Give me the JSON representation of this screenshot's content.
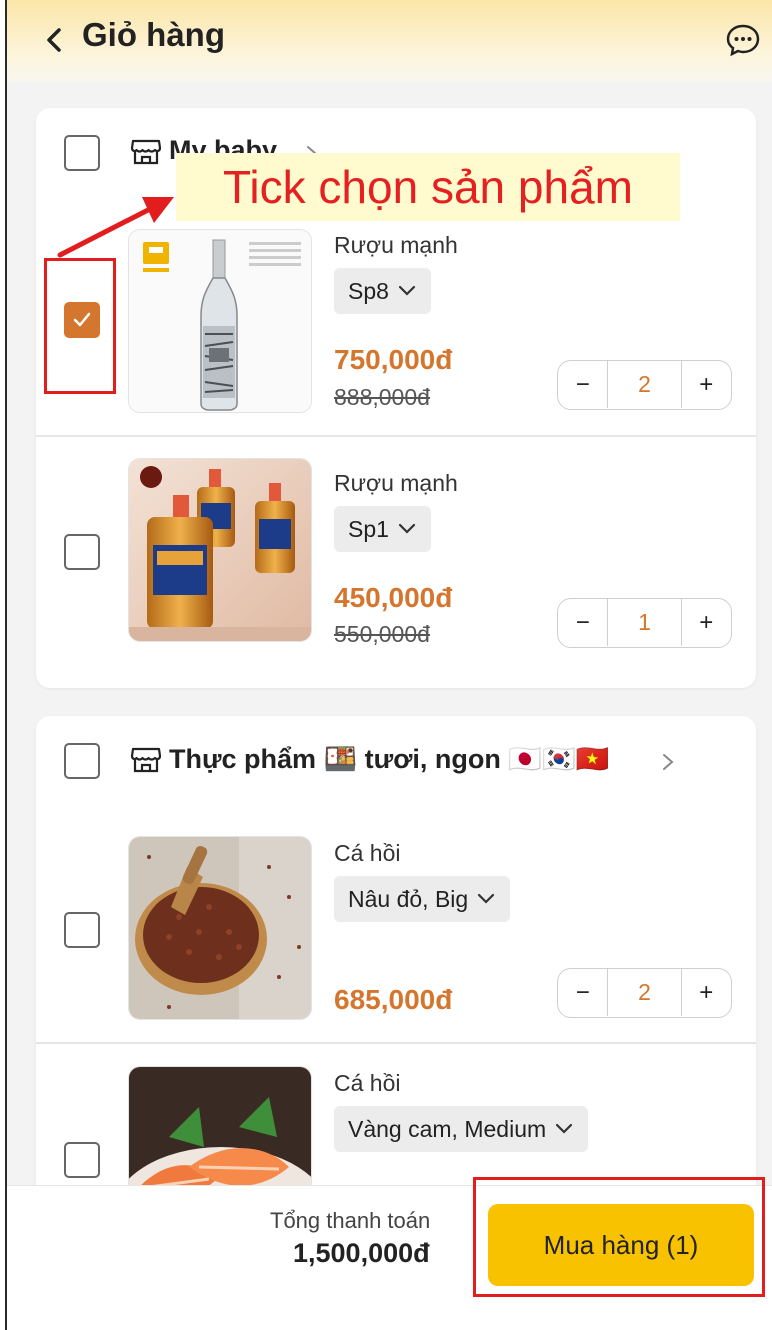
{
  "header": {
    "title": "Giỏ hàng",
    "back_icon": "chevron-left-icon",
    "chat_icon": "chat-bubble-icon"
  },
  "annotations": {
    "tip": "Tick chọn sản phẩm",
    "color": "#e21d1d"
  },
  "shops": [
    {
      "name": "My baby",
      "checked": false,
      "items": [
        {
          "category": "Rượu mạnh",
          "variant": "Sp8",
          "price": "750,000đ",
          "old_price": "888,000đ",
          "qty": "2",
          "checked": true
        },
        {
          "category": "Rượu mạnh",
          "variant": "Sp1",
          "price": "450,000đ",
          "old_price": "550,000đ",
          "qty": "1",
          "checked": false
        }
      ]
    },
    {
      "name": "Thực phẩm 🍱 tươi, ngon 🇯🇵🇰🇷🇻🇳",
      "checked": false,
      "items": [
        {
          "category": "Cá hồi",
          "variant": "Nâu đỏ, Big",
          "price": "685,000đ",
          "qty": "2",
          "checked": false
        },
        {
          "category": "Cá hồi",
          "variant": "Vàng cam, Medium",
          "checked": false
        }
      ]
    }
  ],
  "footer": {
    "total_label": "Tổng thanh toán",
    "total_amount": "1,500,000đ",
    "buy_label": "Mua hàng (1)"
  },
  "colors": {
    "accent": "#d4762d",
    "buy_button": "#f8c200",
    "header_gradient_top": "#fbe6a8"
  }
}
